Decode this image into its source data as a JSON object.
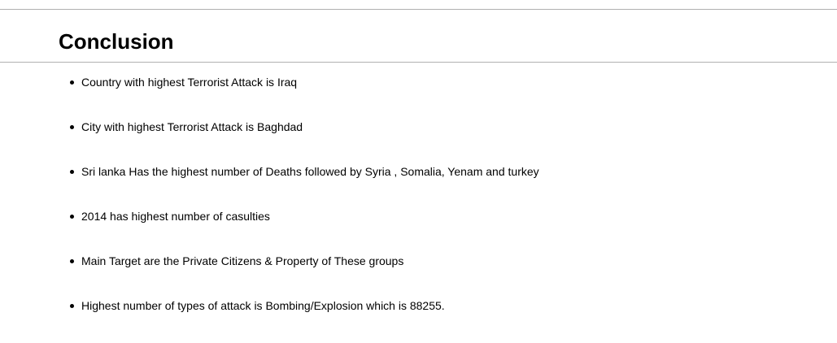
{
  "title": "Conclusion",
  "items": [
    "Country with highest Terrorist Attack is Iraq",
    "City with highest Terrorist Attack is Baghdad",
    "Sri lanka Has the highest number of Deaths followed by Syria , Somalia, Yenam and turkey",
    "2014 has highest number of casulties",
    "Main Target are the Private Citizens & Property of These groups",
    "Highest number of types of attack is Bombing/Explosion which is 88255."
  ]
}
